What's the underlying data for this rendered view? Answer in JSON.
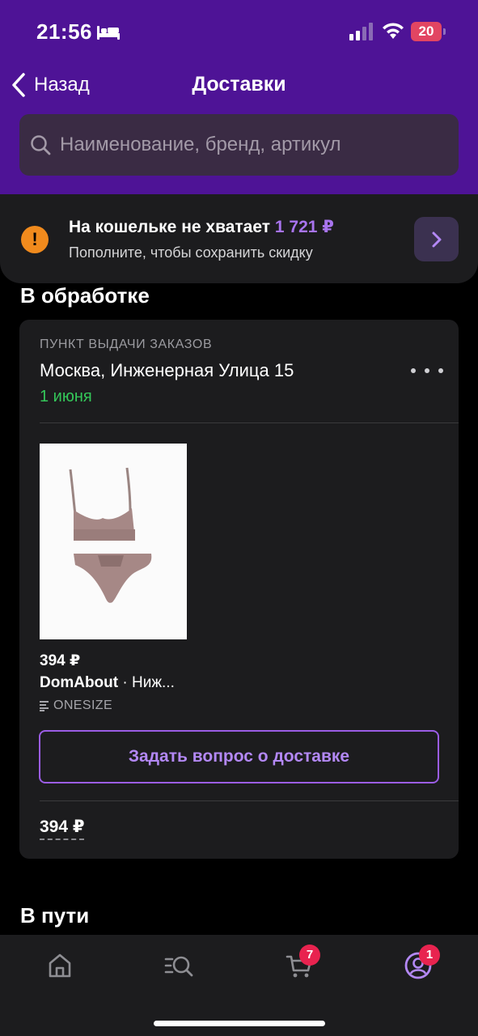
{
  "status_bar": {
    "time": "21:56",
    "battery": "20"
  },
  "nav": {
    "back_label": "Назад",
    "title": "Доставки"
  },
  "search": {
    "placeholder": "Наименование, бренд, артикул"
  },
  "wallet": {
    "title_prefix": "На кошельке не хватает",
    "amount": "1 721 ₽",
    "subtitle": "Пополните, чтобы сохранить скидку"
  },
  "sections": {
    "processing": "В обработке",
    "in_transit": "В пути"
  },
  "order": {
    "pickup_label": "ПУНКТ ВЫДАЧИ ЗАКАЗОВ",
    "address": "Москва, Инженерная Улица 15",
    "date": "1 июня",
    "product": {
      "price": "394 ₽",
      "brand": "DomAbout",
      "name": " · Ниж...",
      "size": "ONESIZE"
    },
    "ask_button": "Задать вопрос о доставке",
    "total": "394 ₽"
  },
  "tabbar": {
    "items": [
      {
        "icon": "home-icon"
      },
      {
        "icon": "catalog-search-icon"
      },
      {
        "icon": "cart-icon",
        "badge": "7"
      },
      {
        "icon": "profile-icon",
        "badge": "1"
      }
    ]
  },
  "colors": {
    "header": "#4e1396",
    "accent": "#a874ee",
    "date_green": "#34c759",
    "warning": "#f08a1d",
    "badge": "#e8234f"
  }
}
